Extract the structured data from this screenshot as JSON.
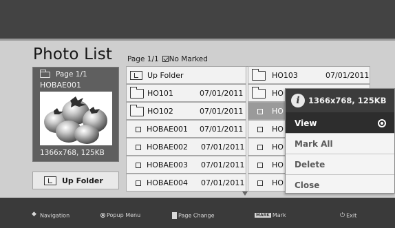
{
  "title": "Photo List",
  "page_info": {
    "page": "Page 1/1",
    "marked": "No Marked"
  },
  "preview": {
    "page": "Page 1/1",
    "filename": "HOBAE001",
    "info": "1366x768, 125KB",
    "image": "tomatoes-thumbnail"
  },
  "left_button": {
    "label": "Up Folder",
    "icon": "up-folder-icon"
  },
  "files": {
    "col1": [
      {
        "name": "Up Folder",
        "date": "",
        "type": "up-folder"
      },
      {
        "name": "HO101",
        "date": "07/01/2011",
        "type": "folder"
      },
      {
        "name": "HO102",
        "date": "07/01/2011",
        "type": "folder"
      },
      {
        "name": "HOBAE001",
        "date": "07/01/2011",
        "type": "photo"
      },
      {
        "name": "HOBAE002",
        "date": "07/01/2011",
        "type": "photo"
      },
      {
        "name": "HOBAE003",
        "date": "07/01/2011",
        "type": "photo"
      },
      {
        "name": "HOBAE004",
        "date": "07/01/2011",
        "type": "photo"
      }
    ],
    "col2": [
      {
        "name": "HO103",
        "date": "07/01/2011",
        "type": "folder"
      },
      {
        "name": "HO",
        "date": "",
        "type": "folder"
      },
      {
        "name": "HO",
        "date": "",
        "type": "photo"
      },
      {
        "name": "HO",
        "date": "",
        "type": "photo"
      },
      {
        "name": "HO",
        "date": "",
        "type": "photo"
      },
      {
        "name": "HO",
        "date": "",
        "type": "photo"
      },
      {
        "name": "HO",
        "date": "",
        "type": "photo"
      }
    ]
  },
  "popup": {
    "header": "1366x768, 125KB",
    "items": [
      {
        "label": "View",
        "selected": true
      },
      {
        "label": "Mark All",
        "selected": false
      },
      {
        "label": "Delete",
        "selected": false
      },
      {
        "label": "Close",
        "selected": false
      }
    ]
  },
  "bottom_bar": [
    {
      "icon": "navigation-icon",
      "label": "Navigation"
    },
    {
      "icon": "ok-button-icon",
      "label": "Popup Menu"
    },
    {
      "icon": "page-up-down-icon",
      "label": "Page Change"
    },
    {
      "icon": "mark-key-icon",
      "icon_text": "MARK",
      "label": "Mark"
    },
    {
      "icon": "exit-icon",
      "label": "Exit"
    }
  ],
  "colors": {
    "panel": "#cfcfcf",
    "popup_active": "#2d2d2d",
    "bars": "#3a3a3a"
  }
}
